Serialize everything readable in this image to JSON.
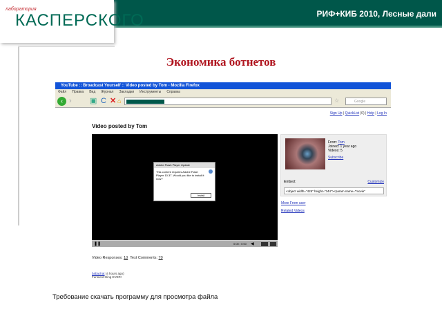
{
  "header": {
    "event": "РИФ+КИБ 2010, Лесные дали",
    "logo_small": "лаборатория",
    "logo_main": "КАСПЕРСКОГО"
  },
  "slide": {
    "title": "Экономика ботнетов",
    "caption": "Требование скачать программу для просмотра файла"
  },
  "browser": {
    "window_title": "YouTube :: Broadcast Yourself :: Video posted by Tom - Mozilla Firefox",
    "menu": [
      "Файл",
      "Правка",
      "Вид",
      "Журнал",
      "Закладки",
      "Инструменты",
      "Справка"
    ],
    "search_placeholder": "Google",
    "top_links": {
      "signup": "Sign Up",
      "quicklist": "QuickList",
      "quicklist_count": "(0)",
      "help": "Help",
      "login": "Log In"
    },
    "page_heading": "Video posted by Tom",
    "dialog": {
      "title": "Adobe Flash Player Update",
      "message": "This content requires Adobe Flash Player 10.37. Would you like to install it now?",
      "button": "Install"
    },
    "player": {
      "time": "0:00 / 0:00"
    },
    "uploader": {
      "from_label": "From:",
      "from": "Tom",
      "joined": "Joined: 1 year ago",
      "videos": "Videos: 5",
      "subscribe": "Subscribe"
    },
    "embed": {
      "label": "Embed:",
      "customize": "Customize",
      "code": "<object width=\"425\" height=\"344\"><param name=\"movie\""
    },
    "more_from_user": "More From user",
    "related_videos": "Related Videos",
    "responses": {
      "video_label": "Video Responses:",
      "video_count": "10",
      "text_label": "Text Comments:",
      "text_count": "70"
    },
    "comment": {
      "user": "babachat",
      "time": "(4 hours ago)",
      "text": "Funniest thing EVER!"
    }
  },
  "colors": {
    "brand_green": "#00574a",
    "title_red": "#b0141e",
    "titlebar_blue": "#1254d8"
  }
}
